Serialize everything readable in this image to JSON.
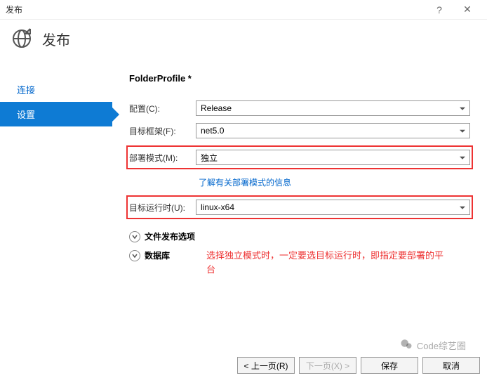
{
  "window": {
    "title": "发布",
    "help": "?",
    "close": "✕"
  },
  "header": {
    "title": "发布"
  },
  "sidebar": {
    "items": [
      {
        "label": "连接"
      },
      {
        "label": "设置"
      }
    ]
  },
  "main": {
    "profile_title": "FolderProfile *",
    "rows": {
      "config": {
        "label": "配置(C):",
        "value": "Release"
      },
      "framework": {
        "label": "目标框架(F):",
        "value": "net5.0"
      },
      "deploy_mode": {
        "label": "部署模式(M):",
        "value": "独立"
      },
      "deploy_info_link": "了解有关部署模式的信息",
      "runtime": {
        "label": "目标运行时(U):",
        "value": "linux-x64"
      }
    },
    "expanders": {
      "file_publish": "文件发布选项",
      "database": "数据库"
    },
    "annotation": "选择独立模式时，一定要选目标运行时，即指定要部署的平台"
  },
  "footer": {
    "prev": "< 上一页(R)",
    "next": "下一页(X) >",
    "save": "保存",
    "cancel": "取消"
  },
  "watermark": "Code综艺圈"
}
